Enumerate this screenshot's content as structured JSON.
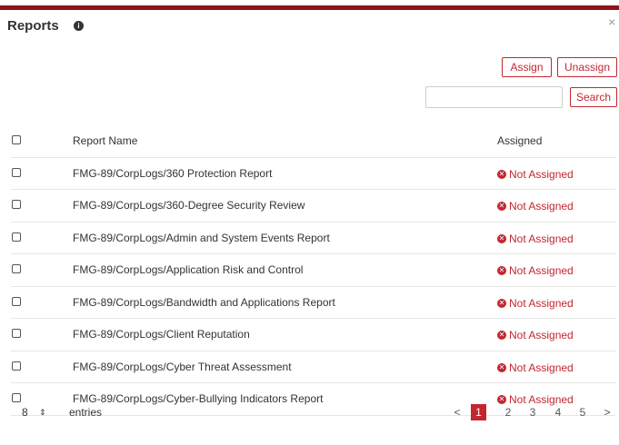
{
  "modal": {
    "title": "Reports",
    "info_icon": "info-circle-icon",
    "close_icon": "close-icon",
    "close_glyph": "×"
  },
  "toolbar": {
    "assign_label": "Assign",
    "unassign_label": "Unassign",
    "search_label": "Search",
    "search_value": "",
    "search_placeholder": ""
  },
  "table": {
    "columns": [
      "",
      "Report Name",
      "Assigned"
    ],
    "rows": [
      {
        "name": "FMG-89/CorpLogs/360 Protection Report",
        "status": "Not Assigned"
      },
      {
        "name": "FMG-89/CorpLogs/360-Degree Security Review",
        "status": "Not Assigned"
      },
      {
        "name": "FMG-89/CorpLogs/Admin and System Events Report",
        "status": "Not Assigned"
      },
      {
        "name": "FMG-89/CorpLogs/Application Risk and Control",
        "status": "Not Assigned"
      },
      {
        "name": "FMG-89/CorpLogs/Bandwidth and Applications Report",
        "status": "Not Assigned"
      },
      {
        "name": "FMG-89/CorpLogs/Client Reputation",
        "status": "Not Assigned"
      },
      {
        "name": "FMG-89/CorpLogs/Cyber Threat Assessment",
        "status": "Not Assigned"
      },
      {
        "name": "FMG-89/CorpLogs/Cyber-Bullying Indicators Report",
        "status": "Not Assigned"
      }
    ]
  },
  "footer": {
    "page_size": "8",
    "page_size_arrows": "⇕",
    "entries_label": "entries",
    "prev": "<",
    "next": ">",
    "pages": [
      "1",
      "2",
      "3",
      "4",
      "5"
    ],
    "current_page": "1"
  },
  "colors": {
    "accent": "#c4262e",
    "header_bar": "#8f1518"
  }
}
